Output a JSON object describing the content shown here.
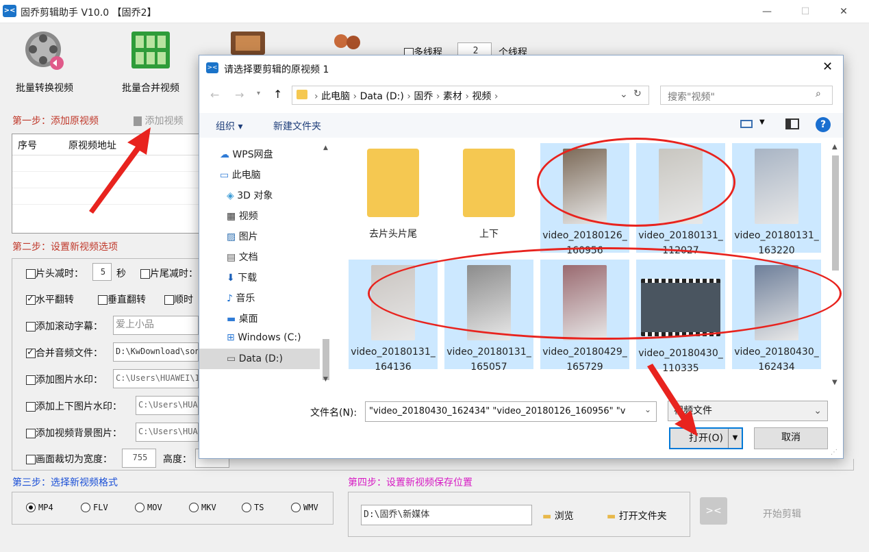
{
  "app": {
    "title": "固乔剪辑助手 V10.0 【固乔2】",
    "icon": "scissors-icon"
  },
  "toolbar": {
    "batch_convert": "批量转换视频",
    "batch_merge": "批量合并视频",
    "multithread_label": "多线程",
    "threads": "2",
    "threads_unit": "个线程"
  },
  "step1": {
    "label": "第一步：添加原视频",
    "add_video": "添加视频",
    "col_no": "序号",
    "col_path": "原视频地址"
  },
  "step2": {
    "label": "第二步：设置新视频选项",
    "head_cut": "片头减时：",
    "head_val": "5",
    "sec": "秒",
    "tail_cut": "片尾减时：",
    "hflip": "水平翻转",
    "vflip": "垂直翻转",
    "clockwise": "顺时",
    "scroll_text": "添加滚动字幕：",
    "scroll_val": "爱上小品",
    "merge_audio": "合并音频文件：",
    "audio_path": "D:\\KwDownload\\son",
    "img_watermark": "添加图片水印：",
    "img_wm_path": "C:\\Users\\HUAWEI\\I",
    "tb_watermark": "添加上下图片水印：",
    "tb_wm_path": "C:\\Users\\HUA",
    "bg_image": "添加视频背景图片：",
    "bg_path": "C:\\Users\\HUA",
    "crop": "画面裁切为宽度：",
    "width": "755",
    "height_label": "高度："
  },
  "step3": {
    "label": "第三步：选择新视频格式",
    "formats": [
      "MP4",
      "FLV",
      "MOV",
      "MKV",
      "TS",
      "WMV"
    ],
    "selected": "MP4"
  },
  "step4": {
    "label": "第四步：设置新视频保存位置",
    "path": "D:\\固乔\\新媒体",
    "browse": "浏览",
    "open_folder": "打开文件夹",
    "start": "开始剪辑"
  },
  "dialog": {
    "title": "请选择要剪辑的原视频 1",
    "breadcrumb": [
      "此电脑",
      "Data (D:)",
      "固乔",
      "素材",
      "视频"
    ],
    "search_placeholder": "搜索\"视频\"",
    "organize": "组织 ▾",
    "new_folder": "新建文件夹",
    "nav": [
      "WPS网盘",
      "此电脑",
      "3D 对象",
      "视频",
      "图片",
      "文档",
      "下载",
      "音乐",
      "桌面",
      "Windows (C:)",
      "Data (D:)"
    ],
    "files": [
      {
        "name": "去片头片尾",
        "kind": "folder"
      },
      {
        "name": "上下",
        "kind": "folder"
      },
      {
        "name": "video_20180126_160956",
        "kind": "video"
      },
      {
        "name": "video_20180131_112027",
        "kind": "video"
      },
      {
        "name": "video_20180131_163220",
        "kind": "video"
      },
      {
        "name": "video_20180131_164136",
        "kind": "video"
      },
      {
        "name": "video_20180131_165057",
        "kind": "video"
      },
      {
        "name": "video_20180429_165729",
        "kind": "video"
      },
      {
        "name": "video_20180430_110335",
        "kind": "video"
      },
      {
        "name": "video_20180430_162434",
        "kind": "video"
      }
    ],
    "filename_label": "文件名(N):",
    "filename_value": "\"video_20180430_162434\" \"video_20180126_160956\" \"v",
    "filetype": "视频文件",
    "open": "打开(O)",
    "cancel": "取消"
  },
  "colors": {
    "annotation": "#e8231e",
    "selection": "#cce8ff"
  }
}
